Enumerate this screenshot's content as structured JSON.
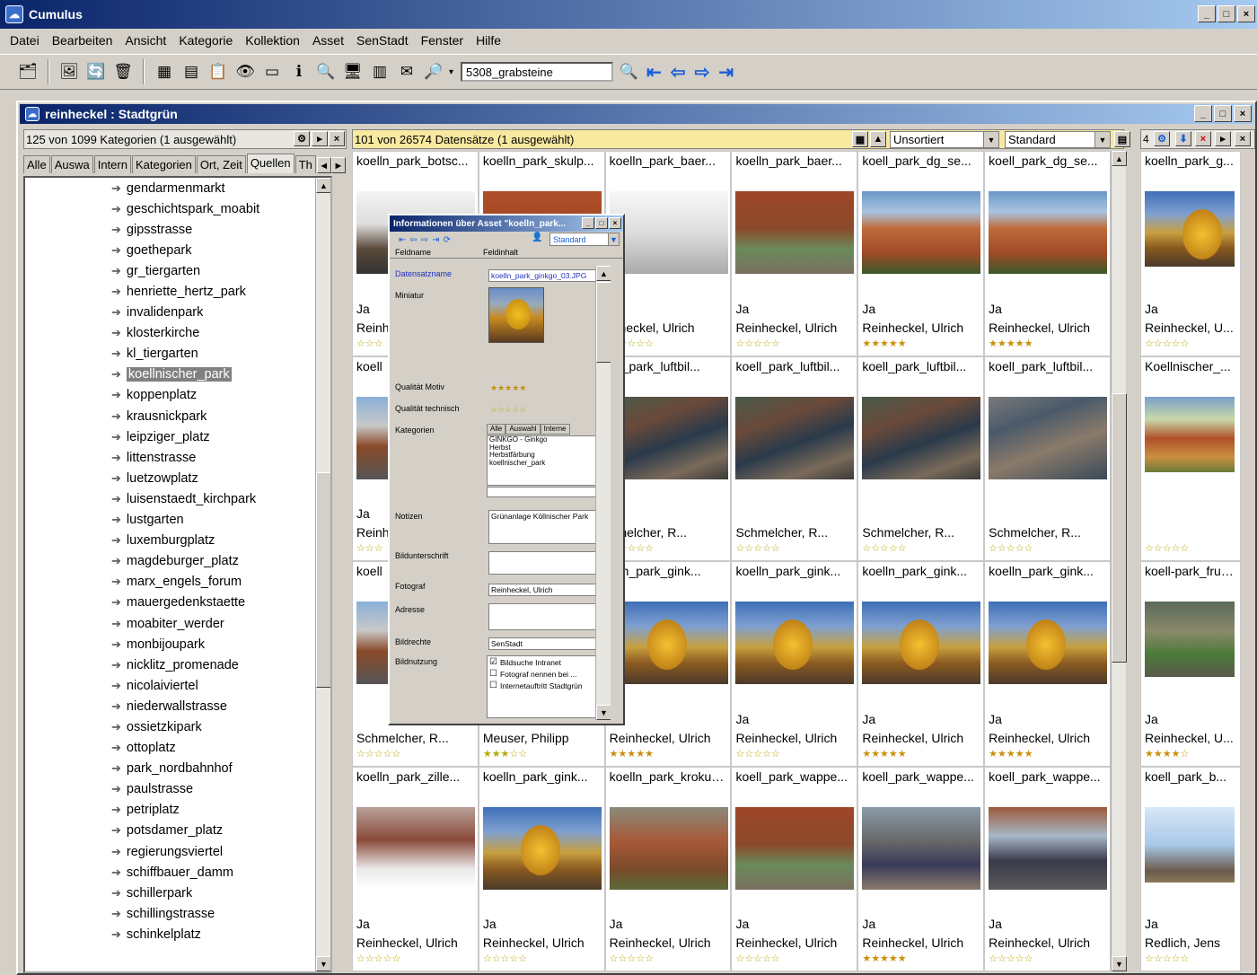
{
  "app": {
    "title": "Cumulus"
  },
  "menu": [
    "Datei",
    "Bearbeiten",
    "Ansicht",
    "Kategorie",
    "Kollektion",
    "Asset",
    "SenStadt",
    "Fenster",
    "Hilfe"
  ],
  "toolbar": {
    "search_value": "5308_grabsteine"
  },
  "window": {
    "title": "reinheckel : Stadtgrün"
  },
  "categories": {
    "header": "125 von 1099 Kategorien (1 ausgewählt)",
    "tabs": [
      "Alle",
      "Auswa",
      "Intern",
      "Kategorien",
      "Ort, Zeit",
      "Quellen",
      "Th"
    ],
    "active_tab": "Quellen",
    "items": [
      "gendarmenmarkt",
      "geschichtspark_moabit",
      "gipsstrasse",
      "goethepark",
      "gr_tiergarten",
      "henriette_hertz_park",
      "invalidenpark",
      "klosterkirche",
      "kl_tiergarten",
      "koellnischer_park",
      "koppenplatz",
      "krausnickpark",
      "leipziger_platz",
      "littenstrasse",
      "luetzowplatz",
      "luisenstaedt_kirchpark",
      "lustgarten",
      "luxemburgplatz",
      "magdeburger_platz",
      "marx_engels_forum",
      "mauergedenkstaette",
      "moabiter_werder",
      "monbijoupark",
      "nicklitz_promenade",
      "nicolaiviertel",
      "niederwallstrasse",
      "ossietzkipark",
      "ottoplatz",
      "park_nordbahnhof",
      "paulstrasse",
      "petriplatz",
      "potsdamer_platz",
      "regierungsviertel",
      "schiffbauer_damm",
      "schillerpark",
      "schillingstrasse",
      "schinkelplatz"
    ],
    "selected": "koellnischer_park"
  },
  "records": {
    "header": "101 von 26574 Datensätze (1 ausgewählt)",
    "sort": "Unsortiert",
    "view": "Standard",
    "cells": [
      {
        "name": "koelln_park_botsc...",
        "ja": "Ja",
        "author": "Reinh",
        "stars": "☆☆☆",
        "rating": 0,
        "img": "skyline"
      },
      {
        "name": "koelln_park_skulp...",
        "ja": "",
        "author": "",
        "stars": "",
        "rating": 0,
        "img": "brick"
      },
      {
        "name": "koelln_park_baer...",
        "ja": "",
        "author": "inheckel, Ulrich",
        "stars": "☆☆☆☆☆",
        "rating": 0,
        "img": "bear"
      },
      {
        "name": "koelln_park_baer...",
        "ja": "Ja",
        "author": "Reinheckel, Ulrich",
        "stars": "☆☆☆☆☆",
        "rating": 0,
        "img": "enclosure"
      },
      {
        "name": "koell_park_dg_se...",
        "ja": "Ja",
        "author": "Reinheckel, Ulrich",
        "stars": "★★★★★",
        "rating": 5,
        "img": "building"
      },
      {
        "name": "koell_park_dg_se...",
        "ja": "Ja",
        "author": "Reinheckel, Ulrich",
        "stars": "★★★★★",
        "rating": 5,
        "img": "building"
      },
      {
        "name": "koell",
        "ja": "Ja",
        "author": "Reinh",
        "stars": "☆☆☆",
        "rating": 0,
        "img": "street"
      },
      {
        "name": "",
        "ja": "",
        "author": "",
        "stars": "",
        "rating": 0,
        "img": ""
      },
      {
        "name": "ell_park_luftbil...",
        "ja": "",
        "author": "hmelcher, R...",
        "stars": "☆☆☆☆☆",
        "rating": 0,
        "img": "aerial"
      },
      {
        "name": "koell_park_luftbil...",
        "ja": "",
        "author": "Schmelcher, R...",
        "stars": "☆☆☆☆☆",
        "rating": 0,
        "img": "aerial"
      },
      {
        "name": "koell_park_luftbil...",
        "ja": "",
        "author": "Schmelcher, R...",
        "stars": "☆☆☆☆☆",
        "rating": 0,
        "img": "aerial"
      },
      {
        "name": "koell_park_luftbil...",
        "ja": "",
        "author": "Schmelcher, R...",
        "stars": "☆☆☆☆☆",
        "rating": 0,
        "img": "aerial2"
      },
      {
        "name": "koell",
        "ja": "",
        "author": "Schmelcher, R...",
        "stars": "☆☆☆☆☆",
        "rating": 0,
        "img": "street"
      },
      {
        "name": "",
        "ja": "",
        "author": "Meuser, Philipp",
        "stars": "★★★☆☆",
        "rating": 3,
        "img": ""
      },
      {
        "name": "elln_park_gink...",
        "ja": "",
        "author": "Reinheckel, Ulrich",
        "stars": "★★★★★",
        "rating": 5,
        "img": "ginkgo"
      },
      {
        "name": "koelln_park_gink...",
        "ja": "Ja",
        "author": "Reinheckel, Ulrich",
        "stars": "☆☆☆☆☆",
        "rating": 0,
        "img": "ginkgo"
      },
      {
        "name": "koelln_park_gink...",
        "ja": "Ja",
        "author": "Reinheckel, Ulrich",
        "stars": "★★★★★",
        "rating": 5,
        "img": "ginkgo"
      },
      {
        "name": "koelln_park_gink...",
        "ja": "Ja",
        "author": "Reinheckel, Ulrich",
        "stars": "★★★★★",
        "rating": 5,
        "img": "ginkgo"
      },
      {
        "name": "koelln_park_zille...",
        "ja": "Ja",
        "author": "Reinheckel, Ulrich",
        "stars": "☆☆☆☆☆",
        "rating": 0,
        "img": "snow"
      },
      {
        "name": "koelln_park_gink...",
        "ja": "Ja",
        "author": "Reinheckel, Ulrich",
        "stars": "☆☆☆☆☆",
        "rating": 0,
        "img": "ginkgo"
      },
      {
        "name": "koelln_park_krokus...",
        "ja": "Ja",
        "author": "Reinheckel, Ulrich",
        "stars": "☆☆☆☆☆",
        "rating": 0,
        "img": "brick2"
      },
      {
        "name": "koell_park_wappe...",
        "ja": "Ja",
        "author": "Reinheckel, Ulrich",
        "stars": "☆☆☆☆☆",
        "rating": 0,
        "img": "enclosure"
      },
      {
        "name": "koell_park_wappe...",
        "ja": "Ja",
        "author": "Reinheckel, Ulrich",
        "stars": "★★★★★",
        "rating": 5,
        "img": "crowd"
      },
      {
        "name": "koell_park_wappe...",
        "ja": "Ja",
        "author": "Reinheckel, Ulrich",
        "stars": "☆☆☆☆☆",
        "rating": 0,
        "img": "crowd2"
      }
    ],
    "right_cells": [
      {
        "name": "koelln_park_g...",
        "ja": "Ja",
        "author": "Reinheckel, U...",
        "stars": "☆☆☆☆☆",
        "rating": 0,
        "img": "ginkgo"
      },
      {
        "name": "Koellnischer_...",
        "ja": "",
        "author": "",
        "stars": "☆☆☆☆☆",
        "rating": 0,
        "img": "church"
      },
      {
        "name": "koell-park_frue...",
        "ja": "Ja",
        "author": "Reinheckel, U...",
        "stars": "★★★★☆",
        "rating": 4,
        "img": "garden"
      },
      {
        "name": "koell_park_b...",
        "ja": "Ja",
        "author": "Redlich, Jens",
        "stars": "☆☆☆☆☆",
        "rating": 0,
        "img": "tree"
      }
    ]
  },
  "dialog": {
    "title": "Informationen über Asset \"koelln_park...",
    "view": "Standard",
    "col_fieldname": "Feldname",
    "col_content": "Feldinhalt",
    "fields": {
      "datensatzname_label": "Datensatzname",
      "datensatzname_value": "koelln_park_ginkgo_03.JPG",
      "miniatur_label": "Miniatur",
      "qualitaet_motiv_label": "Qualität Motiv",
      "qualitaet_motiv_stars": "★★★★★",
      "qualitaet_technisch_label": "Qualität technisch",
      "qualitaet_technisch_stars": "☆☆☆☆☆",
      "kategorien_label": "Kategorien",
      "kat_tabs": [
        "Alle",
        "Auswahl",
        "Interne"
      ],
      "kat_items": [
        "GINKGO - Ginkgo",
        "Herbst",
        "Herbstfärbung",
        "koellnischer_park"
      ],
      "notizen_label": "Notizen",
      "notizen_value": "Grünanlage Köllnischer Park",
      "bildunterschrift_label": "Bildunterschrift",
      "fotograf_label": "Fotograf",
      "fotograf_value": "Reinheckel, Ulrich",
      "adresse_label": "Adresse",
      "bildrechte_label": "Bildrechte",
      "bildrechte_value": "SenStadt",
      "bildnutzung_label": "Bildnutzung",
      "bildnutzung_options": [
        "Bildsuche Intranet",
        "Fotograf nennen bei ...",
        "Internetauftritt Stadtgrün"
      ],
      "bildnutzung_checked": 0
    }
  }
}
